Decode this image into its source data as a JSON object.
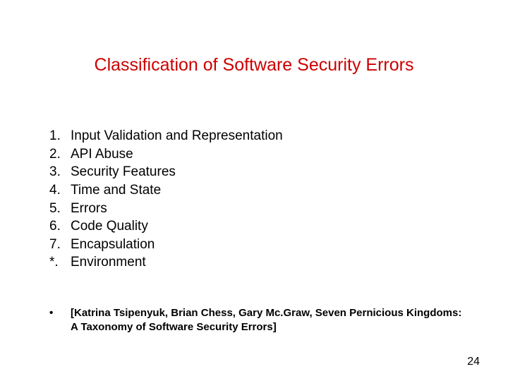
{
  "title": "Classification of Software Security Errors",
  "list": {
    "items": [
      {
        "marker": "1.",
        "text": "Input Validation and Representation"
      },
      {
        "marker": "2.",
        "text": "API Abuse"
      },
      {
        "marker": "3.",
        "text": "Security Features"
      },
      {
        "marker": "4.",
        "text": "Time and State"
      },
      {
        "marker": "5.",
        "text": "Errors"
      },
      {
        "marker": "6.",
        "text": "Code Quality"
      },
      {
        "marker": "7.",
        "text": "Encapsulation"
      },
      {
        "marker": "*.",
        "text": "Environment"
      }
    ]
  },
  "citation": {
    "bullet": "•",
    "text": "[Katrina Tsipenyuk, Brian Chess, Gary Mc.Graw, Seven Pernicious Kingdoms: A Taxonomy of Software Security Errors]"
  },
  "page_number": "24"
}
